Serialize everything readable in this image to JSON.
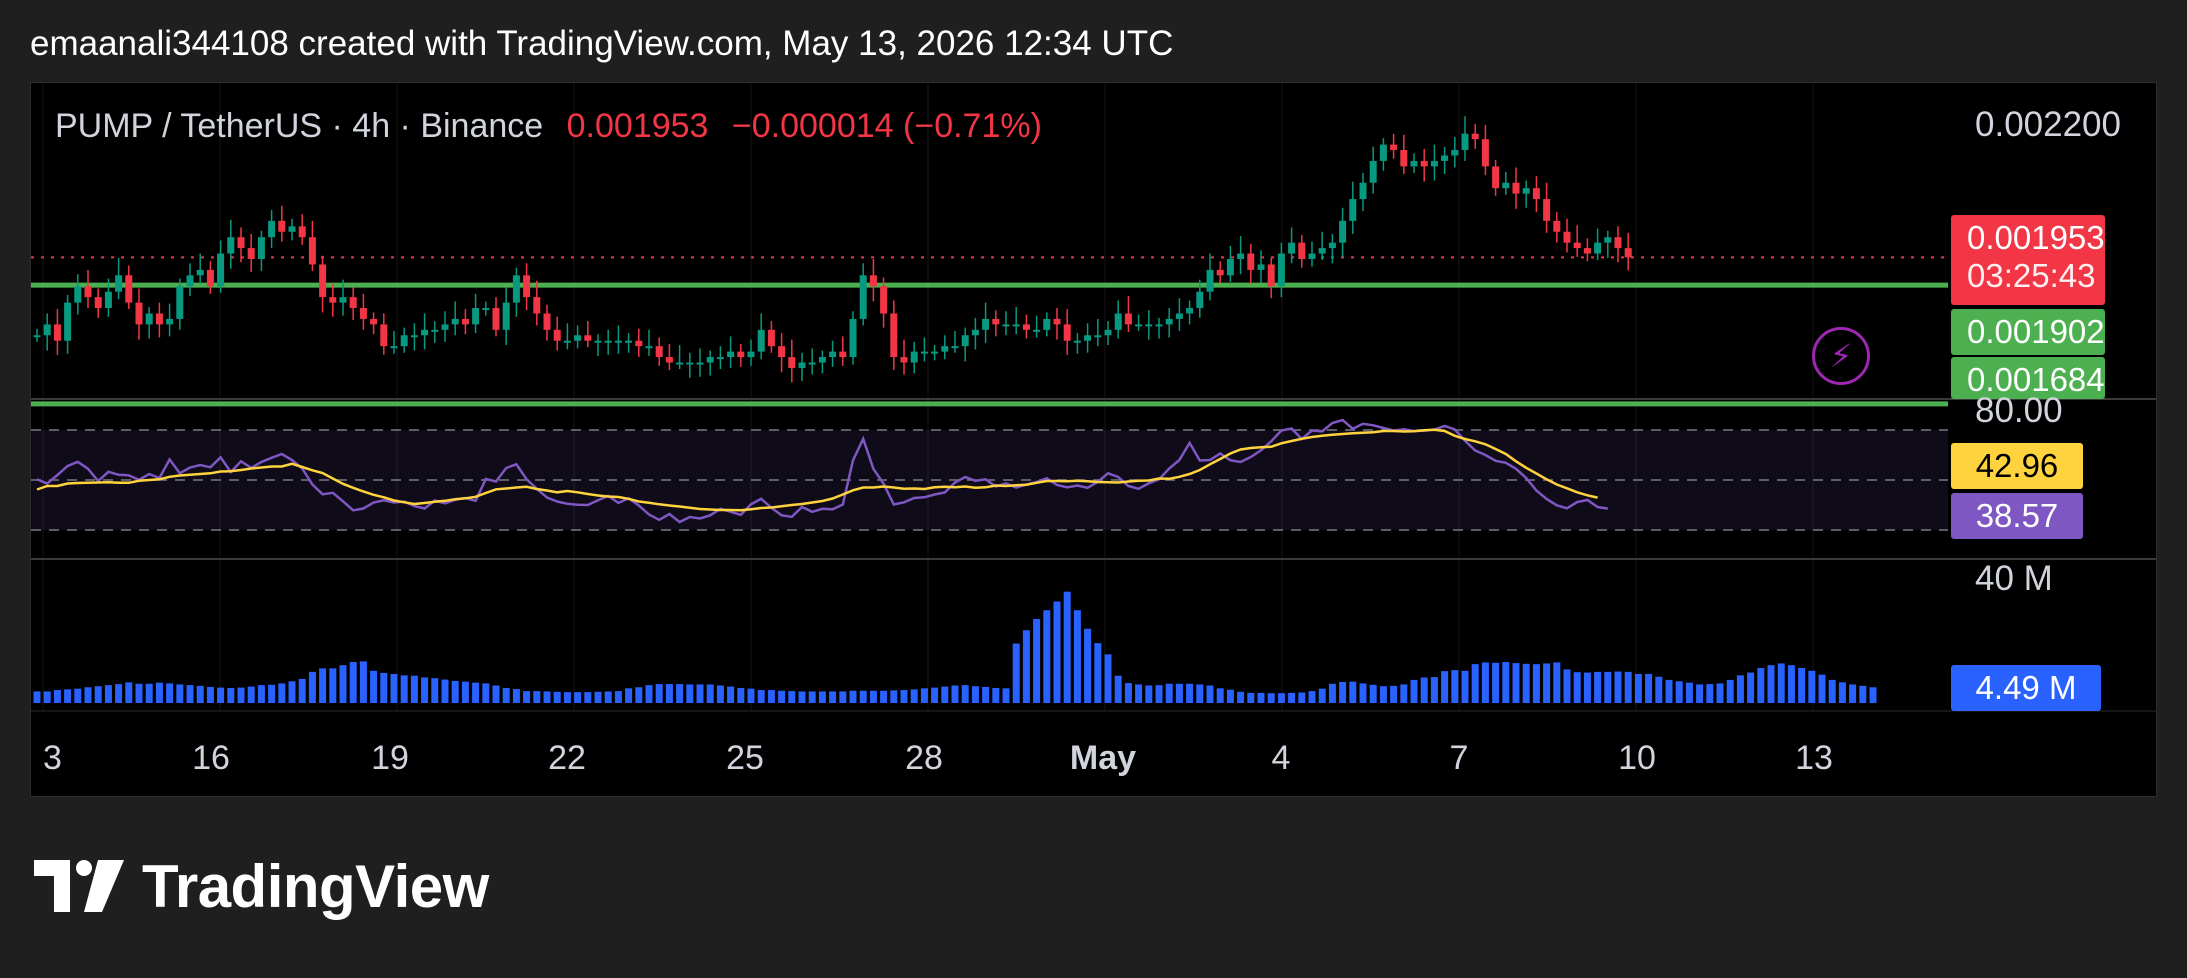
{
  "caption": "emaanali344108 created with TradingView.com, May 13, 2026 12:34 UTC",
  "legend": {
    "symbol": "PUMP / TetherUS · 4h · Binance",
    "last": "0.001953",
    "change": "−0.000014 (−0.71%)"
  },
  "price_axis": {
    "top_label": "0.002200",
    "last_price": "0.001953",
    "countdown": "03:25:43",
    "level1": "0.001902",
    "level2": "0.001684"
  },
  "rsi_axis": {
    "top_label": "80.00",
    "ma_value": "42.96",
    "rsi_value": "38.57"
  },
  "volume_axis": {
    "top_label": "40 M",
    "last_value": "4.49 M"
  },
  "x_axis": {
    "labels": [
      {
        "text": "3",
        "bold": false
      },
      {
        "text": "16",
        "bold": false
      },
      {
        "text": "19",
        "bold": false
      },
      {
        "text": "22",
        "bold": false
      },
      {
        "text": "25",
        "bold": false
      },
      {
        "text": "28",
        "bold": false
      },
      {
        "text": "May",
        "bold": true
      },
      {
        "text": "4",
        "bold": false
      },
      {
        "text": "7",
        "bold": false
      },
      {
        "text": "10",
        "bold": false
      },
      {
        "text": "13",
        "bold": false
      }
    ]
  },
  "brand": "TradingView",
  "colors": {
    "up": "#089981",
    "down": "#f23645",
    "level": "#4caf50",
    "rsi": "#7e57c2",
    "rsi_ma": "#ffd33d",
    "volume": "#2962ff",
    "alert": "#9c27b0"
  },
  "icons": {
    "alert": "lightning-bolt-icon",
    "logo": "tradingview-logo-icon"
  },
  "chart_data": [
    {
      "type": "candlestick",
      "title": "PUMP / TetherUS · 4h · Binance",
      "interval": "4h",
      "ylim": [
        0.00166,
        0.00224
      ],
      "horizontal_levels": [
        0.001902,
        0.001684
      ],
      "last_price": 0.001953,
      "close": [
        0.00181,
        0.00183,
        0.0018,
        0.00187,
        0.0019,
        0.00188,
        0.00186,
        0.00189,
        0.00192,
        0.00187,
        0.00183,
        0.00185,
        0.00183,
        0.00184,
        0.0019,
        0.00192,
        0.00193,
        0.0019,
        0.00196,
        0.00199,
        0.00197,
        0.00195,
        0.00199,
        0.00202,
        0.002,
        0.00201,
        0.00199,
        0.00194,
        0.00188,
        0.00187,
        0.00188,
        0.00186,
        0.00184,
        0.00183,
        0.00179,
        0.00179,
        0.00181,
        0.00181,
        0.00182,
        0.00182,
        0.00183,
        0.00184,
        0.00183,
        0.00186,
        0.00186,
        0.00182,
        0.00187,
        0.00192,
        0.00188,
        0.00185,
        0.00182,
        0.0018,
        0.0018,
        0.00181,
        0.0018,
        0.0018,
        0.0018,
        0.0018,
        0.0018,
        0.00179,
        0.00179,
        0.00177,
        0.00176,
        0.00176,
        0.00176,
        0.00176,
        0.00177,
        0.00177,
        0.00178,
        0.00177,
        0.00178,
        0.00182,
        0.00179,
        0.00177,
        0.00175,
        0.00176,
        0.00176,
        0.00177,
        0.00178,
        0.00177,
        0.00184,
        0.00192,
        0.0019,
        0.00185,
        0.00177,
        0.00176,
        0.00178,
        0.00178,
        0.00178,
        0.00179,
        0.00179,
        0.00181,
        0.00182,
        0.00184,
        0.00183,
        0.00183,
        0.00183,
        0.00182,
        0.00182,
        0.00184,
        0.00183,
        0.0018,
        0.0018,
        0.00181,
        0.00181,
        0.00182,
        0.00185,
        0.00183,
        0.00183,
        0.00183,
        0.00183,
        0.00184,
        0.00185,
        0.00186,
        0.00189,
        0.00193,
        0.00192,
        0.00195,
        0.00196,
        0.00193,
        0.00194,
        0.0019,
        0.00196,
        0.00198,
        0.00195,
        0.00196,
        0.00197,
        0.00198,
        0.00202,
        0.00206,
        0.00209,
        0.00213,
        0.00216,
        0.00215,
        0.00212,
        0.00213,
        0.00212,
        0.00213,
        0.00214,
        0.00215,
        0.00218,
        0.00217,
        0.00212,
        0.00208,
        0.00209,
        0.00207,
        0.00208,
        0.00206,
        0.00202,
        0.002,
        0.00198,
        0.00197,
        0.00196,
        0.00198,
        0.00199,
        0.00197,
        0.001953
      ]
    },
    {
      "type": "line",
      "title": "",
      "ylim": [
        20,
        80
      ],
      "bands": [
        70,
        50,
        30
      ],
      "series": [
        {
          "values": [
            50.3,
            48.6,
            52.0,
            55.6,
            57.3,
            54.5,
            49.6,
            53.3,
            52.1,
            51.9,
            50.1,
            52.4,
            50.8,
            58.2,
            52.7,
            55.0,
            56.0,
            55.1,
            59.1,
            53.2,
            57.5,
            54.9,
            57.2,
            58.9,
            60.4,
            58.0,
            54.6,
            48.2,
            44.3,
            44.9,
            41.5,
            37.9,
            38.6,
            41.0,
            41.9,
            41.0,
            41.4,
            39.6,
            38.6,
            41.8,
            40.7,
            42.1,
            42.8,
            41.7,
            50.4,
            49.4,
            54.8,
            56.3,
            50.3,
            46.5,
            43.0,
            41.4,
            40.5,
            40.1,
            40.0,
            41.9,
            43.7,
            40.8,
            42.7,
            39.8,
            36.2,
            34.1,
            36.4,
            33.2,
            35.2,
            34.6,
            35.9,
            38.5,
            37.3,
            36.1,
            40.3,
            42.5,
            38.9,
            35.9,
            35.3,
            39.2,
            37.3,
            38.5,
            38.3,
            40.2,
            57.9,
            66.5,
            54.5,
            48.5,
            40.2,
            41.1,
            42.8,
            43.1,
            44.2,
            45.0,
            49.0,
            51.2,
            49.7,
            50.3,
            47.4,
            48.6,
            47.0,
            48.2,
            49.2,
            50.7,
            48.0,
            47.1,
            47.8,
            46.9,
            49.3,
            52.7,
            51.2,
            47.6,
            46.5,
            48.7,
            50.3,
            54.6,
            58.0,
            64.9,
            57.8,
            58.0,
            60.6,
            57.9,
            57.2,
            59.2,
            61.9,
            65.5,
            69.8,
            70.6,
            66.4,
            69.8,
            69.5,
            72.8,
            74.0,
            70.5,
            72.5,
            71.9,
            70.8,
            69.8,
            70.3,
            69.6,
            69.7,
            70.2,
            71.6,
            70.2,
            65.7,
            61.8,
            60.0,
            57.7,
            56.9,
            54.5,
            50.8,
            45.8,
            42.4,
            39.9,
            38.7,
            41.2,
            42.0,
            39.2,
            38.57
          ]
        },
        {
          "values": [
            46.2,
            47.6,
            47.6,
            48.6,
            48.8,
            48.9,
            49.0,
            49.1,
            48.9,
            48.9,
            49.7,
            50.0,
            50.3,
            51.3,
            51.8,
            52.1,
            52.4,
            52.7,
            53.4,
            53.5,
            54.0,
            54.6,
            55.0,
            55.4,
            55.4,
            56.5,
            55.2,
            53.9,
            52.8,
            50.6,
            48.5,
            46.9,
            45.4,
            44.1,
            43.1,
            41.8,
            41.1,
            40.4,
            40.8,
            41.3,
            41.7,
            42.3,
            42.7,
            43.3,
            44.8,
            46.3,
            46.6,
            47.0,
            47.3,
            46.4,
            45.8,
            45.1,
            45.6,
            45.1,
            44.4,
            43.8,
            43.4,
            43.2,
            42.5,
            41.4,
            40.9,
            40.3,
            39.8,
            39.4,
            38.9,
            38.4,
            38.2,
            38.0,
            38.0,
            37.9,
            38.3,
            38.8,
            39.0,
            39.5,
            40.0,
            40.4,
            41.0,
            41.6,
            42.6,
            44.2,
            45.9,
            47.0,
            47.0,
            47.4,
            47.0,
            46.5,
            46.6,
            46.4,
            47.1,
            47.3,
            47.1,
            47.4,
            46.9,
            47.1,
            47.8,
            47.6,
            47.9,
            48.1,
            48.9,
            49.6,
            49.6,
            49.5,
            49.7,
            49.5,
            49.2,
            49.1,
            49.0,
            49.4,
            49.7,
            49.8,
            50.6,
            50.5,
            51.3,
            52.4,
            54.0,
            56.3,
            58.4,
            60.6,
            62.2,
            62.8,
            63.1,
            63.3,
            64.7,
            65.6,
            66.5,
            67.2,
            67.7,
            68.1,
            68.4,
            68.7,
            68.9,
            69.1,
            69.6,
            69.6,
            69.4,
            69.5,
            69.9,
            70.1,
            69.6,
            67.7,
            66.4,
            65.5,
            64.3,
            62.4,
            60.4,
            57.5,
            54.9,
            52.6,
            50.3,
            48.2,
            46.7,
            45.1,
            43.9,
            42.96
          ]
        }
      ]
    },
    {
      "type": "bar",
      "title": "",
      "ylim": [
        0,
        40
      ],
      "values": [
        3.3,
        3.3,
        3.7,
        3.9,
        4.1,
        4.5,
        4.8,
        5.1,
        5.4,
        5.9,
        5.5,
        5.5,
        5.8,
        5.6,
        5.3,
        5.1,
        4.9,
        4.6,
        4.4,
        4.3,
        4.4,
        4.7,
        5.1,
        5.2,
        5.6,
        6.2,
        6.9,
        8.9,
        9.9,
        9.9,
        10.8,
        11.7,
        11.9,
        9.2,
        8.6,
        8.3,
        7.9,
        7.8,
        7.3,
        7.1,
        6.7,
        6.3,
        6.1,
        5.8,
        5.6,
        5.0,
        4.3,
        4.0,
        3.4,
        3.4,
        3.3,
        3.2,
        3.1,
        3.1,
        3.1,
        3.2,
        3.3,
        3.4,
        4.2,
        4.5,
        5.1,
        5.4,
        5.4,
        5.4,
        5.3,
        5.3,
        5.3,
        5.0,
        4.7,
        4.3,
        4.1,
        3.7,
        3.7,
        3.5,
        3.4,
        3.3,
        3.3,
        3.3,
        3.3,
        3.3,
        3.5,
        3.5,
        3.5,
        3.5,
        3.6,
        3.7,
        3.9,
        4.2,
        4.4,
        4.7,
        5.0,
        5.1,
        4.8,
        4.6,
        4.3,
        4.2,
        17.0,
        20.8,
        24.0,
        26.5,
        29.0,
        31.8,
        26.5,
        21.2,
        17.1,
        13.9,
        7.8,
        5.7,
        5.3,
        5.0,
        5.1,
        5.5,
        5.5,
        5.5,
        5.3,
        5.0,
        4.2,
        3.8,
        3.2,
        2.9,
        2.9,
        2.8,
        2.8,
        2.9,
        3.0,
        3.4,
        4.1,
        5.5,
        6.0,
        6.1,
        5.6,
        5.2,
        4.8,
        4.9,
        5.3,
        6.6,
        7.3,
        7.4,
        9.1,
        9.4,
        9.2,
        11.1,
        11.6,
        11.5,
        11.7,
        11.4,
        11.2,
        11.1,
        11.3,
        11.6,
        9.6,
        8.8,
        8.7,
        8.9,
        8.9,
        9.0,
        8.9,
        8.3,
        8.3,
        7.5,
        6.6,
        6.2,
        5.8,
        5.3,
        5.4,
        5.6,
        6.6,
        7.9,
        8.7,
        10.0,
        10.8,
        11.3,
        10.8,
        10.0,
        9.2,
        8.1,
        6.6,
        5.9,
        5.3,
        4.9,
        4.49
      ]
    }
  ]
}
